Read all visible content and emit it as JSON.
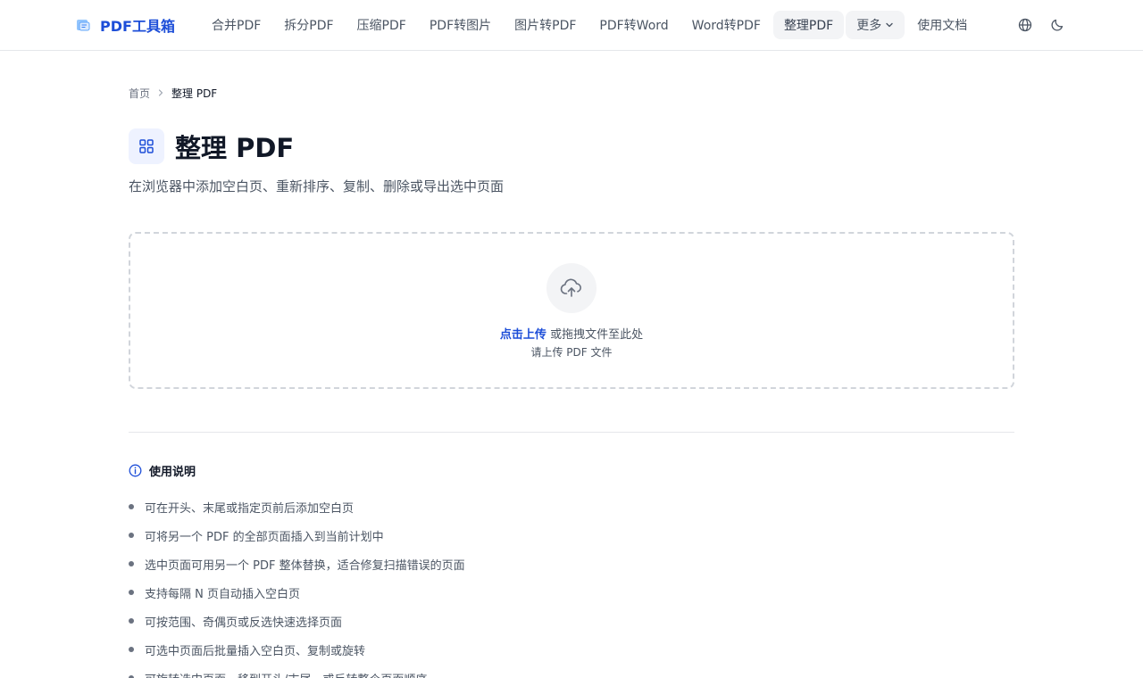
{
  "brand": {
    "name": "PDF工具箱"
  },
  "nav": {
    "items": [
      {
        "label": "合并PDF"
      },
      {
        "label": "拆分PDF"
      },
      {
        "label": "压缩PDF"
      },
      {
        "label": "PDF转图片"
      },
      {
        "label": "图片转PDF"
      },
      {
        "label": "PDF转Word"
      },
      {
        "label": "Word转PDF"
      },
      {
        "label": "整理PDF",
        "active": true
      }
    ],
    "more_label": "更多",
    "docs_label": "使用文档"
  },
  "header_icons": [
    "globe-icon",
    "moon-icon"
  ],
  "breadcrumb": {
    "home": "首页",
    "current": "整理 PDF"
  },
  "page": {
    "title": "整理 PDF",
    "title_icon": "grid-icon",
    "subtitle": "在浏览器中添加空白页、重新排序、复制、删除或导出选中页面"
  },
  "upload": {
    "icon": "cloud-upload-icon",
    "link_text": "点击上传",
    "drag_text": " 或拖拽文件至此处",
    "hint": "请上传 PDF 文件"
  },
  "instructions": {
    "icon": "info-icon",
    "title": "使用说明",
    "items": [
      "可在开头、末尾或指定页前后添加空白页",
      "可将另一个 PDF 的全部页面插入到当前计划中",
      "选中页面可用另一个 PDF 整体替换，适合修复扫描错误的页面",
      "支持每隔 N 页自动插入空白页",
      "可按范围、奇偶页或反选快速选择页面",
      "可选中页面后批量插入空白页、复制或旋转",
      "可旋转选中页面、移到开头/末尾，或反转整个页面顺序"
    ]
  },
  "colors": {
    "accent": "#1d4ed8",
    "text": "#111827",
    "muted": "#4b5563",
    "border": "#e5e7eb",
    "dashed_border": "#d1d5db",
    "active_bg": "#f3f4f6"
  }
}
